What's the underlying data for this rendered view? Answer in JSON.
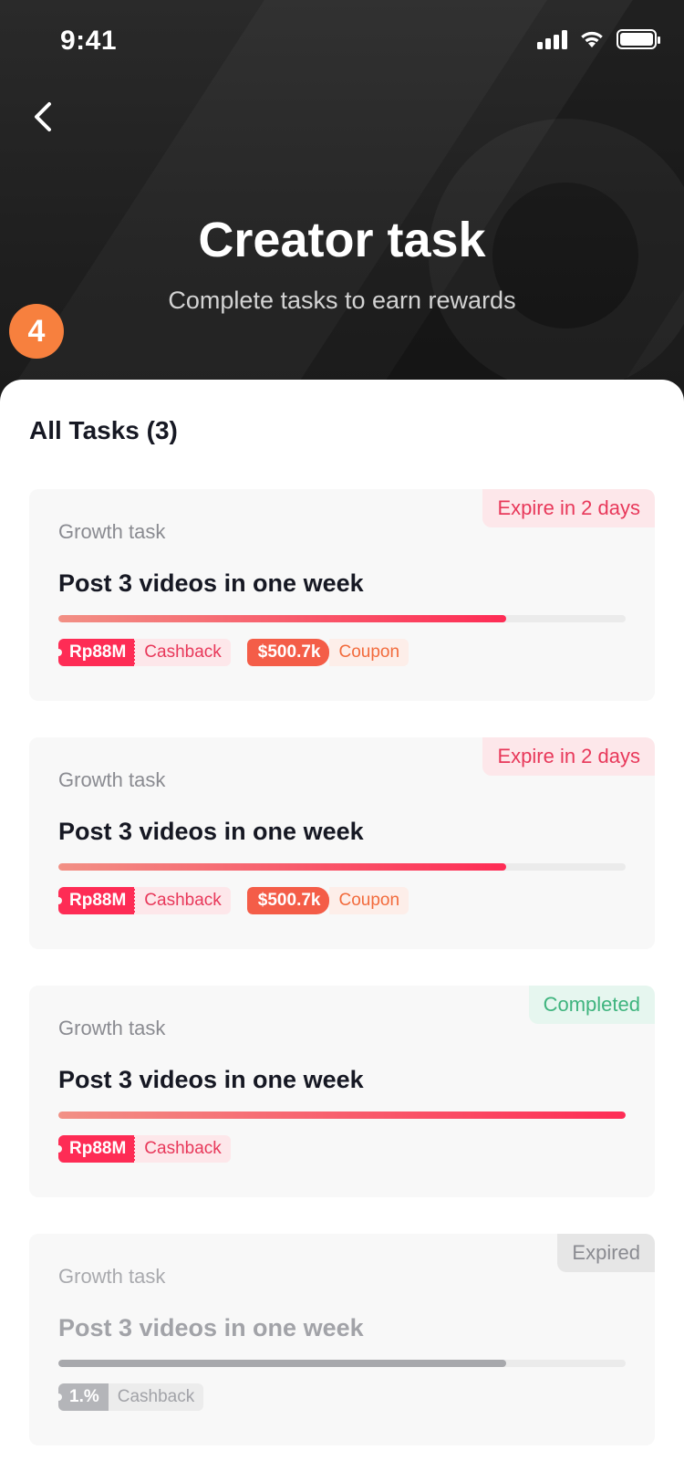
{
  "status_bar": {
    "time": "9:41"
  },
  "header": {
    "title": "Creator task",
    "subtitle": "Complete tasks to earn rewards",
    "step_badge": "4"
  },
  "section": {
    "title": "All Tasks (3)"
  },
  "tasks": [
    {
      "status": "Expire in 2 days",
      "category": "Growth task",
      "name": "Post 3 videos in one week",
      "progress": 0.79,
      "rewards": [
        {
          "value": "Rp88M",
          "label": "Cashback"
        },
        {
          "value": "$500.7k",
          "label": "Coupon"
        }
      ]
    },
    {
      "status": "Expire in 2 days",
      "category": "Growth task",
      "name": "Post 3 videos in one week",
      "progress": 0.79,
      "rewards": [
        {
          "value": "Rp88M",
          "label": "Cashback"
        },
        {
          "value": "$500.7k",
          "label": "Coupon"
        }
      ]
    },
    {
      "status": "Completed",
      "category": "Growth task",
      "name": "Post 3 videos in one week",
      "progress": 1.0,
      "rewards": [
        {
          "value": "Rp88M",
          "label": "Cashback"
        }
      ]
    },
    {
      "status": "Expired",
      "category": "Growth task",
      "name": "Post 3 videos in one week",
      "progress": 0.79,
      "rewards": [
        {
          "value": "1.%",
          "label": "Cashback"
        }
      ]
    }
  ],
  "icons": {
    "back": "chevron-left-icon",
    "signal": "cellular-signal-icon",
    "wifi": "wifi-icon",
    "battery": "battery-icon"
  },
  "colors": {
    "accent": "#fe2c55",
    "coupon": "#f45d48",
    "completed": "#3fb47e",
    "step_badge": "#f7803e"
  }
}
